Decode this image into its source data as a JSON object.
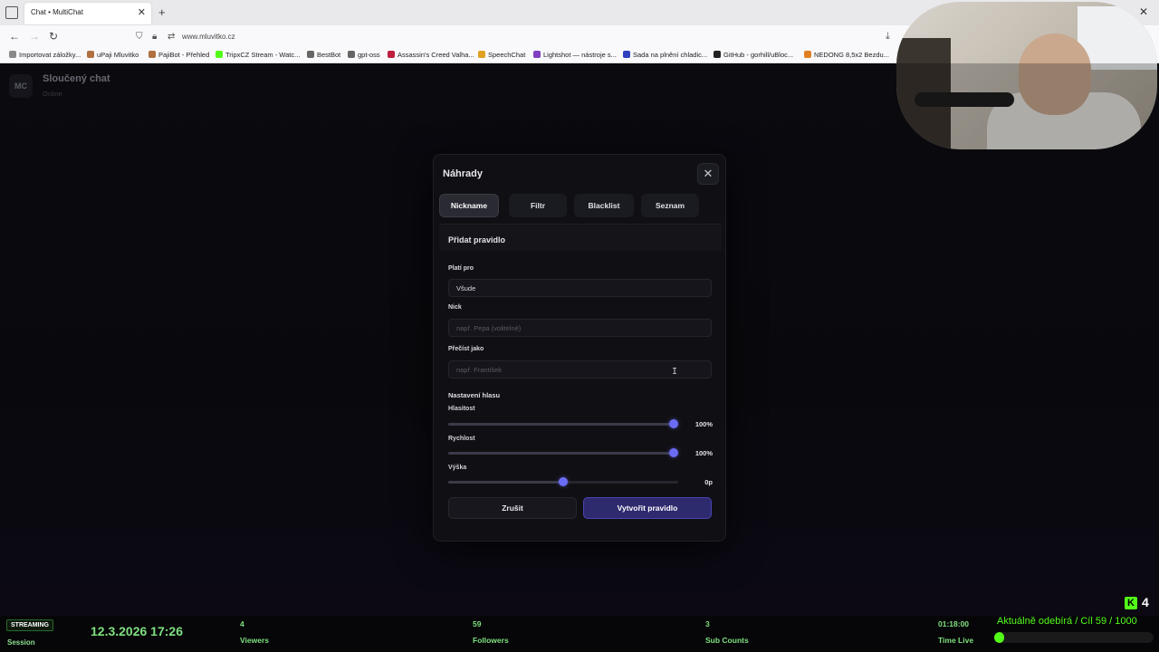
{
  "browser": {
    "tab_title": "Chat • MultiChat",
    "url": "www.mluvitko.cz",
    "bookmarks": [
      {
        "label": "Importovat záložky...",
        "color": "#888888"
      },
      {
        "label": "uPaji Mluvitko",
        "color": "#b07040"
      },
      {
        "label": "PajiBot - Přehled",
        "color": "#b07040"
      },
      {
        "label": "TripxCZ Stream - Watc...",
        "color": "#53fc18"
      },
      {
        "label": "BestBot",
        "color": "#666666"
      },
      {
        "label": "gpt-oss",
        "color": "#666666"
      },
      {
        "label": "Assassin's Creed Valha...",
        "color": "#c02040"
      },
      {
        "label": "SpeechChat",
        "color": "#e0a020"
      },
      {
        "label": "Lightshot — nástroje s...",
        "color": "#8040c0"
      },
      {
        "label": "Sada na plnění chladic...",
        "color": "#3040c0"
      },
      {
        "label": "GitHub - gorhill/uBloc...",
        "color": "#222222"
      },
      {
        "label": "NEDONG 8,5x2 Bezdu...",
        "color": "#e08020"
      }
    ]
  },
  "app": {
    "avatar": "MC",
    "title": "Sloučený chat",
    "status": "Online"
  },
  "modal": {
    "title": "Náhrady",
    "tabs": [
      "Nickname",
      "Filtr",
      "Blacklist",
      "Seznam"
    ],
    "active_tab": 0,
    "panel_title": "Přidat pravidlo",
    "applies_label": "Platí pro",
    "applies_value": "Všude",
    "nick_label": "Nick",
    "nick_placeholder": "např. Pepa (volitelné)",
    "read_as_label": "Přečíst jako",
    "read_as_placeholder": "např. František",
    "voice_section": "Nastavení hlasu",
    "sliders": [
      {
        "label": "Hlasitost",
        "value_text": "100%",
        "fraction": 1.0
      },
      {
        "label": "Rychlost",
        "value_text": "100%",
        "fraction": 1.0
      },
      {
        "label": "Výška",
        "value_text": "0p",
        "fraction": 0.5
      }
    ],
    "cancel_label": "Zrušit",
    "create_label": "Vytvořit pravidlo"
  },
  "stats": {
    "badge": "STREAMING",
    "session_label": "Session",
    "datetime": "12.3.2026 17:26",
    "viewers_num": "4",
    "viewers_label": "Viewers",
    "followers_num": "59",
    "followers_label": "Followers",
    "subs_num": "3",
    "subs_label": "Sub Counts",
    "time_live": "01:18:00",
    "time_live_label": "Time Live",
    "kick_count": "4",
    "goal_text": "Aktuálně odebírá / Cíl  59 / 1000",
    "goal_fraction": 0.059
  },
  "colors": {
    "accent": "#6b6cf6",
    "kick_green": "#53fc18"
  }
}
